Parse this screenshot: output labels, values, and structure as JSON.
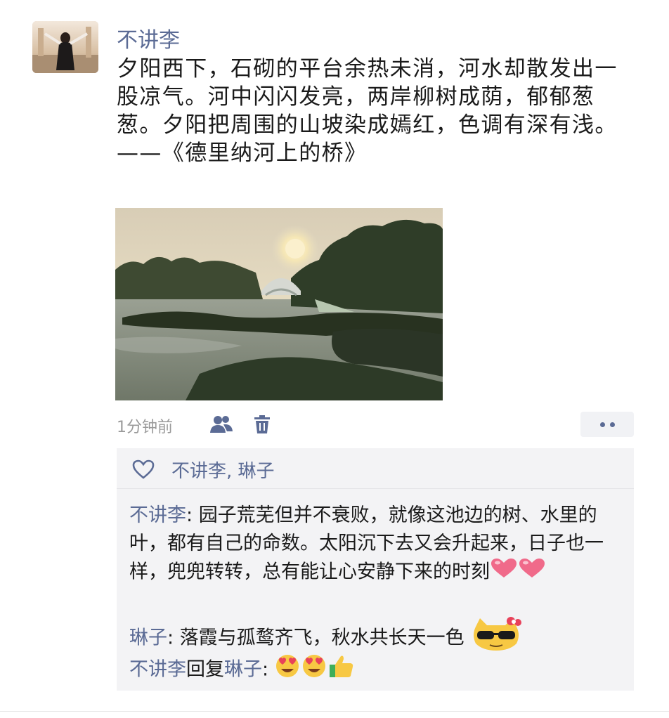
{
  "post": {
    "author": "不讲李",
    "text": "夕阳西下，石砌的平台余热未消，河水却散发出一股凉气。河中闪闪发亮，两岸柳树成荫，郁郁葱葱。夕阳把周围的山坡染成嫣红，色调有深有浅。——《德里纳河上的桥》",
    "time": "1分钟前"
  },
  "icons": {
    "avatar": "avatar-woman-arms-raised",
    "visibility": "people-icon",
    "delete": "trash-icon",
    "more": "more-dots-icon",
    "like": "heart-outline-icon"
  },
  "likes": {
    "names": "不讲李, 琳子"
  },
  "comments": [
    {
      "author": "不讲李",
      "sep": ": ",
      "text": "园子荒芜但并不衰败，就像这池边的树、水里的叶，都有自己的命数。太阳沉下去又会升起来，日子也一样，兜兜转转，总有能让心安静下来的时刻",
      "emojis": "❤❤"
    },
    {
      "author": "琳子",
      "sep": ": ",
      "text": "落霞与孤鹜齐飞，秋水共长天一色",
      "emojis": "sunglasses-cat-emoji"
    },
    {
      "author": "不讲李",
      "reply_word": "回复",
      "reply_to": "琳子",
      "sep": ": ",
      "emojis": "😍😍👍"
    }
  ],
  "colors": {
    "name_blue": "#5b6b95",
    "time_gray": "#9a9a9a",
    "panel_bg": "#f3f3f5",
    "heart_pink": "#f06a8a"
  }
}
